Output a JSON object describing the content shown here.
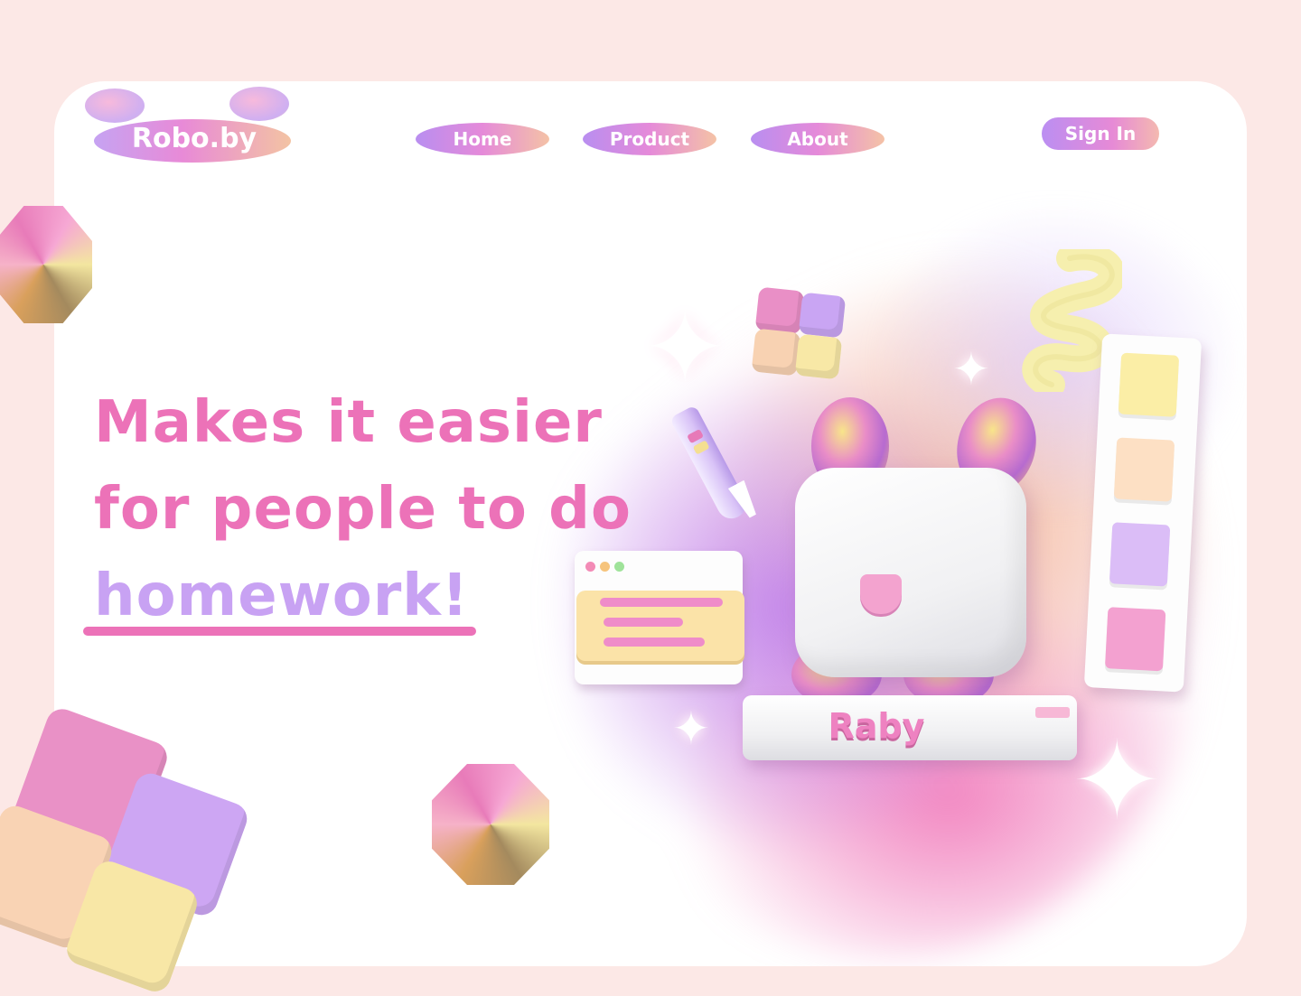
{
  "brand": {
    "logo_text": "Robo.by"
  },
  "nav": {
    "items": [
      {
        "label": "Home"
      },
      {
        "label": "Product"
      },
      {
        "label": "About"
      }
    ],
    "signin_label": "Sign In"
  },
  "hero": {
    "line1": "Makes it easier",
    "line2": "for people to do",
    "highlight": "homework!"
  },
  "product": {
    "name": "Raby"
  },
  "colors": {
    "page_bg": "#fce8e6",
    "headline": "#ec72b8",
    "highlight": "#c8a2f3",
    "accent_gradient_start": "#b98ef0",
    "accent_gradient_end": "#f4c2a6"
  },
  "icons": {
    "window_dots": [
      "red-dot-icon",
      "yellow-dot-icon",
      "green-dot-icon"
    ]
  }
}
